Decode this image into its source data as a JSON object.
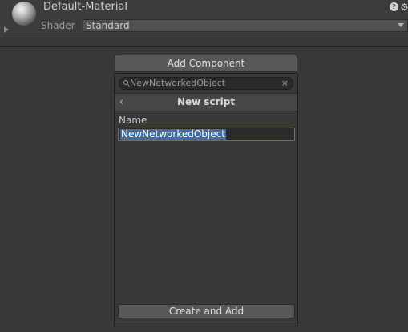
{
  "material": {
    "name": "Default-Material",
    "shader_label": "Shader",
    "shader_value": "Standard",
    "help_icon": "help-icon",
    "settings_icon": "settings-icon"
  },
  "add_component": {
    "button_label": "Add Component",
    "search": {
      "value": "NewNetworkedObject",
      "clear_glyph": "×"
    },
    "nav": {
      "back_glyph": "‹",
      "title": "New script"
    },
    "form": {
      "name_label": "Name",
      "name_value": "NewNetworkedObject"
    },
    "create_button_label": "Create and Add"
  },
  "colors": {
    "background": "#383838",
    "button": "#585858",
    "selection": "#3a6ea5",
    "focus_border": "#3a79bb"
  }
}
